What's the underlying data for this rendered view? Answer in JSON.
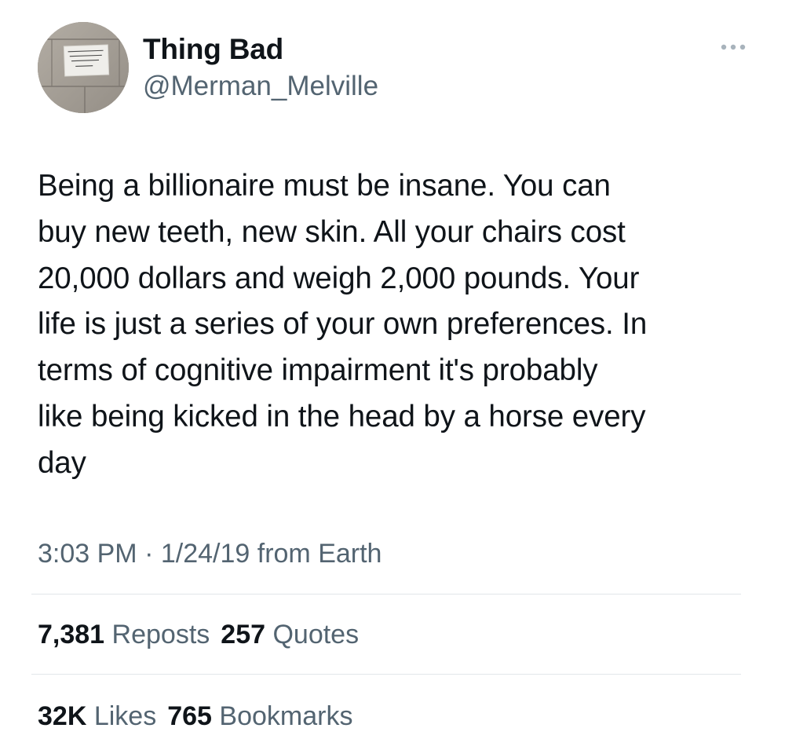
{
  "author": {
    "display_name": "Thing Bad",
    "handle": "@Merman_Melville",
    "avatar_icon": "avatar-photo-sign-on-tile-wall"
  },
  "menu": {
    "icon": "more-horizontal-icon"
  },
  "tweet": {
    "text": "Being a billionaire must be insane. You can\nbuy new teeth, new skin. All your chairs cost\n20,000 dollars and weigh 2,000 pounds. Your\nlife is just a series of your own preferences. In\nterms of cognitive impairment it's probably\nlike being kicked in the head by a horse every\nday",
    "time": "3:03 PM",
    "separator": " · ",
    "date": "1/24/19",
    "source": "from Earth"
  },
  "stats": {
    "reposts": {
      "count": "7,381",
      "label": "Reposts"
    },
    "quotes": {
      "count": "257",
      "label": "Quotes"
    },
    "likes": {
      "count": "32K",
      "label": "Likes"
    },
    "bookmarks": {
      "count": "765",
      "label": "Bookmarks"
    }
  },
  "colors": {
    "text_primary": "#0f1419",
    "text_secondary": "#536471",
    "divider": "#e1e6ea",
    "background": "#ffffff"
  }
}
